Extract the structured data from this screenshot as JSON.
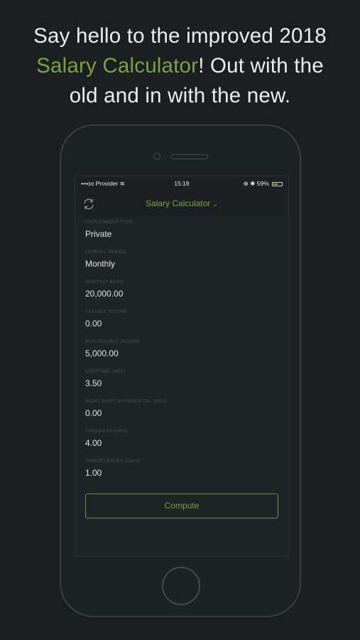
{
  "headline": {
    "line1": "Say hello to the improved 2018",
    "accent": "Salary Calculator",
    "line2_rest": "! Out with the",
    "line3": "old and in with the new."
  },
  "status_bar": {
    "signal": "•••oo",
    "carrier": "Provider",
    "wifi_icon": "wifi-icon",
    "time": "15:18",
    "right_icons": "⊕ ✱",
    "battery": "59%",
    "battery_level": 0.59
  },
  "nav": {
    "title": "Salary Calculator",
    "title_chevron": "⌄"
  },
  "fields": [
    {
      "label": "Employment Type",
      "value": "Private"
    },
    {
      "label": "Payroll Period",
      "value": "Monthly"
    },
    {
      "label": "Monthly Basic",
      "value": "20,000.00"
    },
    {
      "label": "Taxable Income",
      "value": "0.00"
    },
    {
      "label": "Non-Taxable Income",
      "value": "5,000.00"
    },
    {
      "label": "Overtime (Hrs)",
      "value": "3.50"
    },
    {
      "label": "Night Shift Differential (Hrs)",
      "value": "0.00"
    },
    {
      "label": "Tardiness (Hrs)",
      "value": "4.00"
    },
    {
      "label": "Unpaid Leaves (Days)",
      "value": "1.00"
    }
  ],
  "compute_label": "Compute",
  "colors": {
    "accent": "#7ba346",
    "background": "#1b1f21"
  }
}
